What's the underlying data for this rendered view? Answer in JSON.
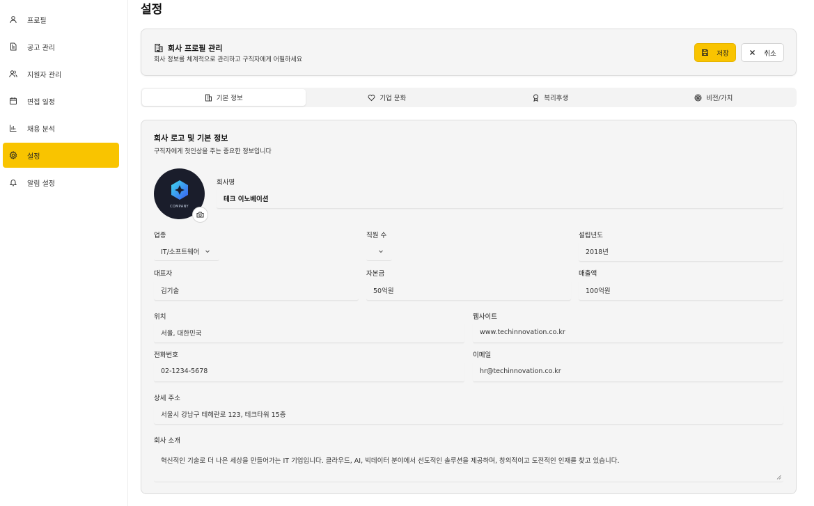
{
  "sidebar": {
    "items": [
      {
        "label": "프로필",
        "icon": "user-icon"
      },
      {
        "label": "공고 관리",
        "icon": "document-icon"
      },
      {
        "label": "지원자 관리",
        "icon": "users-icon"
      },
      {
        "label": "면접 일정",
        "icon": "calendar-icon"
      },
      {
        "label": "채용 분석",
        "icon": "bar-chart-icon"
      },
      {
        "label": "설정",
        "icon": "gear-icon",
        "active": true
      },
      {
        "label": "알림 설정",
        "icon": "bell-icon"
      }
    ]
  },
  "page": {
    "title": "설정"
  },
  "header": {
    "title": "회사 프로필 관리",
    "subtitle": "회사 정보를 체계적으로 관리하고 구직자에게 어필하세요",
    "save_label": "저장",
    "cancel_label": "취소"
  },
  "tabs": [
    {
      "label": "기본 정보",
      "icon": "building-icon",
      "active": true
    },
    {
      "label": "기업 문화",
      "icon": "heart-icon"
    },
    {
      "label": "복리후생",
      "icon": "award-icon"
    },
    {
      "label": "비전/가치",
      "icon": "target-icon"
    }
  ],
  "form": {
    "title": "회사 로고 및 기본 정보",
    "subtitle": "구직자에게 첫인상을 주는 중요한 정보입니다",
    "logo_text": "COMPANY",
    "company_name": {
      "label": "회사명",
      "value": "테크 이노베이션"
    },
    "industry": {
      "label": "업종",
      "value": "IT/소프트웨어"
    },
    "employees": {
      "label": "직원 수",
      "value": ""
    },
    "founded": {
      "label": "설립년도",
      "value": "2018년"
    },
    "ceo": {
      "label": "대표자",
      "value": "김기술"
    },
    "capital": {
      "label": "자본금",
      "value": "50억원"
    },
    "revenue": {
      "label": "매출액",
      "value": "100억원"
    },
    "location": {
      "label": "위치",
      "value": "서울, 대한민국"
    },
    "website": {
      "label": "웹사이트",
      "value": "www.techinnovation.co.kr"
    },
    "phone": {
      "label": "전화번호",
      "value": "02-1234-5678"
    },
    "email": {
      "label": "이메일",
      "value": "hr@techinnovation.co.kr"
    },
    "address": {
      "label": "상세 주소",
      "value": "서울시 강남구 테헤란로 123, 테크타워 15층"
    },
    "intro": {
      "label": "회사 소개",
      "value": "혁신적인 기술로 더 나은 세상을 만들어가는 IT 기업입니다. 클라우드, AI, 빅데이터 분야에서 선도적인 솔루션을 제공하며, 창의적이고 도전적인 인재를 찾고 있습니다."
    }
  },
  "colors": {
    "accent": "#f9c400",
    "card_bg": "#f5f5f5",
    "logo_bg": "#1a1d2b"
  }
}
